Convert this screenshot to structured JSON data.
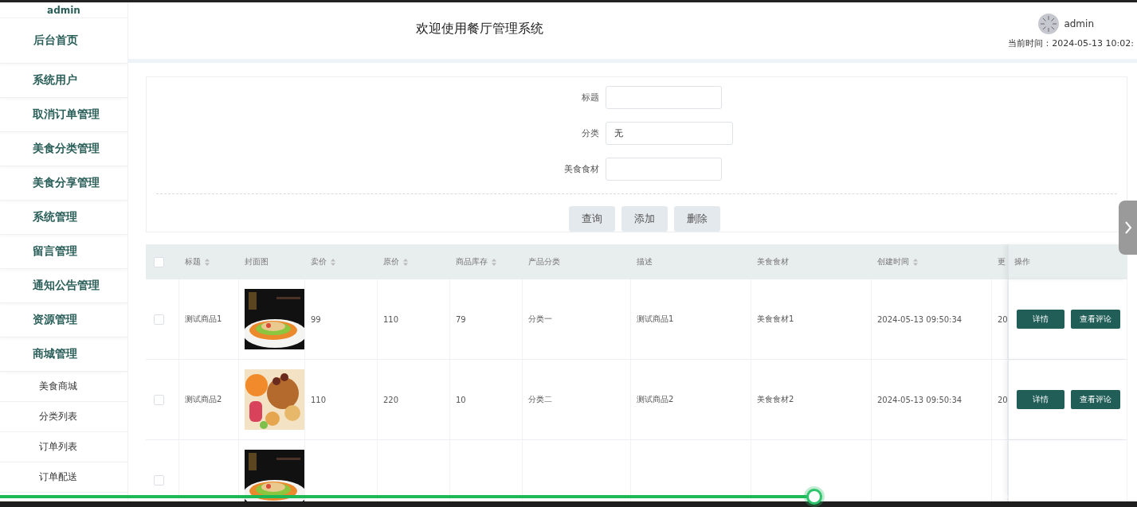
{
  "sidebar": {
    "user": "admin",
    "items": [
      {
        "label": "后台首页",
        "kind": "menu"
      },
      {
        "label": "系统用户",
        "kind": "menu"
      },
      {
        "label": "取消订单管理",
        "kind": "menu"
      },
      {
        "label": "美食分类管理",
        "kind": "menu"
      },
      {
        "label": "美食分享管理",
        "kind": "menu"
      },
      {
        "label": "系统管理",
        "kind": "menu"
      },
      {
        "label": "留言管理",
        "kind": "menu"
      },
      {
        "label": "通知公告管理",
        "kind": "menu"
      },
      {
        "label": "资源管理",
        "kind": "menu"
      },
      {
        "label": "商城管理",
        "kind": "menu"
      },
      {
        "label": "美食商城",
        "kind": "submenu"
      },
      {
        "label": "分类列表",
        "kind": "submenu"
      },
      {
        "label": "订单列表",
        "kind": "submenu"
      },
      {
        "label": "订单配送",
        "kind": "submenu"
      }
    ]
  },
  "header": {
    "title": "欢迎使用餐厅管理系统",
    "user": "admin",
    "time": "当前时间：2024-05-13 10:02:"
  },
  "search": {
    "fields": [
      {
        "label": "标题",
        "wide": false
      },
      {
        "label": "分类",
        "value": "无",
        "wide": true
      },
      {
        "label": "美食食材",
        "wide": false
      }
    ],
    "buttons": [
      "查询",
      "添加",
      "删除"
    ]
  },
  "table": {
    "columns": [
      {
        "label": "标题",
        "sortable": true
      },
      {
        "label": "封面图",
        "sortable": false
      },
      {
        "label": "卖价",
        "sortable": true
      },
      {
        "label": "原价",
        "sortable": true
      },
      {
        "label": "商品库存",
        "sortable": true
      },
      {
        "label": "产品分类",
        "sortable": false
      },
      {
        "label": "描述",
        "sortable": false
      },
      {
        "label": "美食食材",
        "sortable": false
      },
      {
        "label": "创建时间",
        "sortable": true
      },
      {
        "label": "更"
      },
      {
        "label": "操作",
        "sortable": false
      }
    ],
    "all_checked": false,
    "rows": [
      {
        "checked": false,
        "cells": [
          "测试商品1",
          {
            "kind": "picture"
          },
          "99",
          "110",
          "79",
          "分类一",
          "测试商品1",
          "美食食材1",
          "2024-05-13 09:50:34",
          "20"
        ],
        "actions": [
          "详情",
          "查看评论"
        ]
      },
      {
        "checked": false,
        "cells": [
          "测试商品2",
          {
            "kind": "picture"
          },
          "110",
          "220",
          "10",
          "分类二",
          "测试商品2",
          "美食食材2",
          "2024-05-13 09:50:34",
          "20"
        ],
        "actions": [
          "详情",
          "查看评论"
        ]
      },
      {
        "checked": false,
        "cells": [
          "",
          {
            "kind": "picture"
          },
          "",
          "",
          "",
          "",
          "",
          "",
          "",
          ""
        ],
        "actions": []
      }
    ]
  },
  "player": {
    "level": 0.716
  }
}
